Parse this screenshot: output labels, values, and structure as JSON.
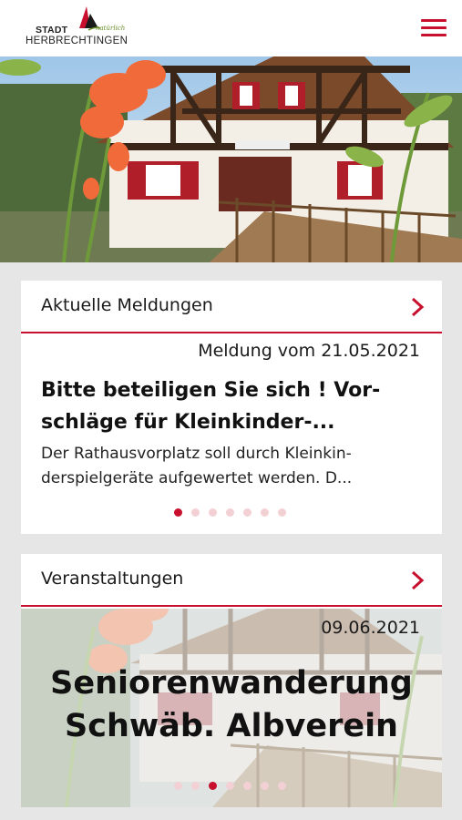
{
  "header": {
    "logo": {
      "line1": "STADT",
      "line2": "HERBRECHTINGEN",
      "tagline": "natürlich"
    },
    "menu_icon": "hamburger-menu-icon"
  },
  "hero": {
    "image": "half-timbered-house-with-gladiolus-photo"
  },
  "news": {
    "section_title": "Aktuelle Meldungen",
    "chevron_icon": "chevron-right-icon",
    "date": "Meldung vom 21.05.2021",
    "headline_line1": "Bitte beteiligen Sie sich ! Vor-",
    "headline_line2": "schläge für Kleinkinder-...",
    "teaser_line1": "Der Rathausvorplatz soll durch Kleinkin-",
    "teaser_line2": "derspielgeräte aufgewertet werden. D...",
    "pagination": {
      "count": 7,
      "active_index": 0
    }
  },
  "events": {
    "section_title": "Veranstaltungen",
    "chevron_icon": "chevron-right-icon",
    "date": "09.06.2021",
    "title_line1": "Seniorenwanderung",
    "title_line2": "Schwäb. Albverein",
    "pagination": {
      "count": 7,
      "active_index": 2
    }
  },
  "colors": {
    "accent": "#c8102e",
    "background": "#e6e6e6",
    "logo_green": "#6b8f2a"
  }
}
